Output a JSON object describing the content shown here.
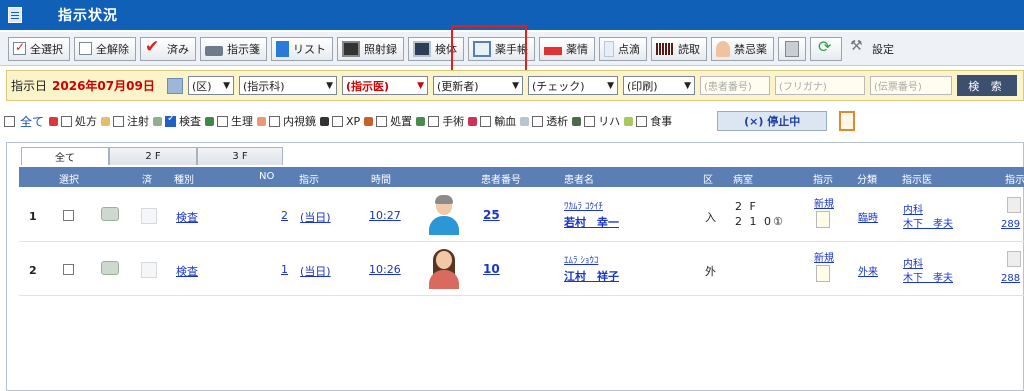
{
  "window": {
    "title": "指示状況"
  },
  "toolbar": {
    "buttons": [
      {
        "label": "全選択",
        "icon": "checkbox-checked-icon"
      },
      {
        "label": "全解除",
        "icon": "checkbox-empty-icon"
      },
      {
        "label": "済み",
        "icon": "red-check-icon"
      },
      {
        "label": "指示箋",
        "icon": "printer-icon"
      },
      {
        "label": "リスト",
        "icon": "list-icon"
      },
      {
        "label": "照射録",
        "icon": "xray-icon"
      },
      {
        "label": "検体",
        "icon": "specimen-tube-icon"
      },
      {
        "label": "薬手帳",
        "icon": "book-icon"
      },
      {
        "label": "薬情",
        "icon": "medicine-info-icon"
      },
      {
        "label": "点滴",
        "icon": "drip-icon"
      },
      {
        "label": "読取",
        "icon": "barcode-icon"
      },
      {
        "label": "禁忌薬",
        "icon": "nurse-icon"
      },
      {
        "label": "設定",
        "icon": "wrench-icon"
      }
    ]
  },
  "filter": {
    "date_label": "指示日",
    "date_value": "2026年07月09日",
    "selects": {
      "ward": "(区)",
      "dept": "(指示科)",
      "doctor": "(指示医)",
      "updater": "(更新者)",
      "check": "(チェック)",
      "print": "(印刷)"
    },
    "placeholders": {
      "patient_no": "(患者番号)",
      "furigana": "(フリガナ)",
      "slip_no": "(伝票番号)"
    },
    "search_label": "検 索"
  },
  "categories": {
    "all_label": "全て",
    "items": [
      {
        "label": "処方",
        "checked": false,
        "color": "#d83a3a"
      },
      {
        "label": "注射",
        "checked": false,
        "color": "#e0c070"
      },
      {
        "label": "検査",
        "checked": true,
        "color": "#8fb08f"
      },
      {
        "label": "生理",
        "checked": false,
        "color": "#3b8a4a"
      },
      {
        "label": "内視鏡",
        "checked": false,
        "color": "#e89a70"
      },
      {
        "label": "XP",
        "checked": false,
        "color": "#333333"
      },
      {
        "label": "処置",
        "checked": false,
        "color": "#c8602a"
      },
      {
        "label": "手術",
        "checked": false,
        "color": "#4a8a4a"
      },
      {
        "label": "輸血",
        "checked": false,
        "color": "#cc3355"
      },
      {
        "label": "透析",
        "checked": false,
        "color": "#b8c4d0"
      },
      {
        "label": "リハ",
        "checked": false,
        "color": "#4a6a4a"
      },
      {
        "label": "食事",
        "checked": false,
        "color": "#a8c860"
      }
    ],
    "stop_label": "(×) 停止中"
  },
  "tabs": [
    "全て",
    "2 F",
    "3 F"
  ],
  "table": {
    "headers": {
      "select": "選択",
      "done": "済",
      "type": "種別",
      "no": "NO",
      "instruction": "指示",
      "time": "時間",
      "patient_no": "患者番号",
      "patient_name": "患者名",
      "ward_class": "区",
      "room": "病室",
      "instr2": "指示",
      "category": "分類",
      "doctor": "指示医",
      "instr3": "指示"
    },
    "rows": [
      {
        "index": "1",
        "type": "検査",
        "no": "2",
        "instruction": "(当日)",
        "time": "10:27",
        "patient_no": "25",
        "kana": "ﾜｶﾑﾗ ｺｳｲﾁ",
        "name": "若村　幸一",
        "ward_class": "入",
        "room_floor": "2 F",
        "room_no": "2 1 0①",
        "status": "新規",
        "category": "臨時",
        "dept": "内科",
        "doctor": "木下　孝夫",
        "slip": "289",
        "gender": "male"
      },
      {
        "index": "2",
        "type": "検査",
        "no": "1",
        "instruction": "(当日)",
        "time": "10:26",
        "patient_no": "10",
        "kana": "ｴﾑﾗ ｼｮｳｺ",
        "name": "江村　祥子",
        "ward_class": "外",
        "room_floor": "",
        "room_no": "",
        "status": "新規",
        "category": "外来",
        "dept": "内科",
        "doctor": "木下　孝夫",
        "slip": "288",
        "gender": "female"
      }
    ]
  }
}
